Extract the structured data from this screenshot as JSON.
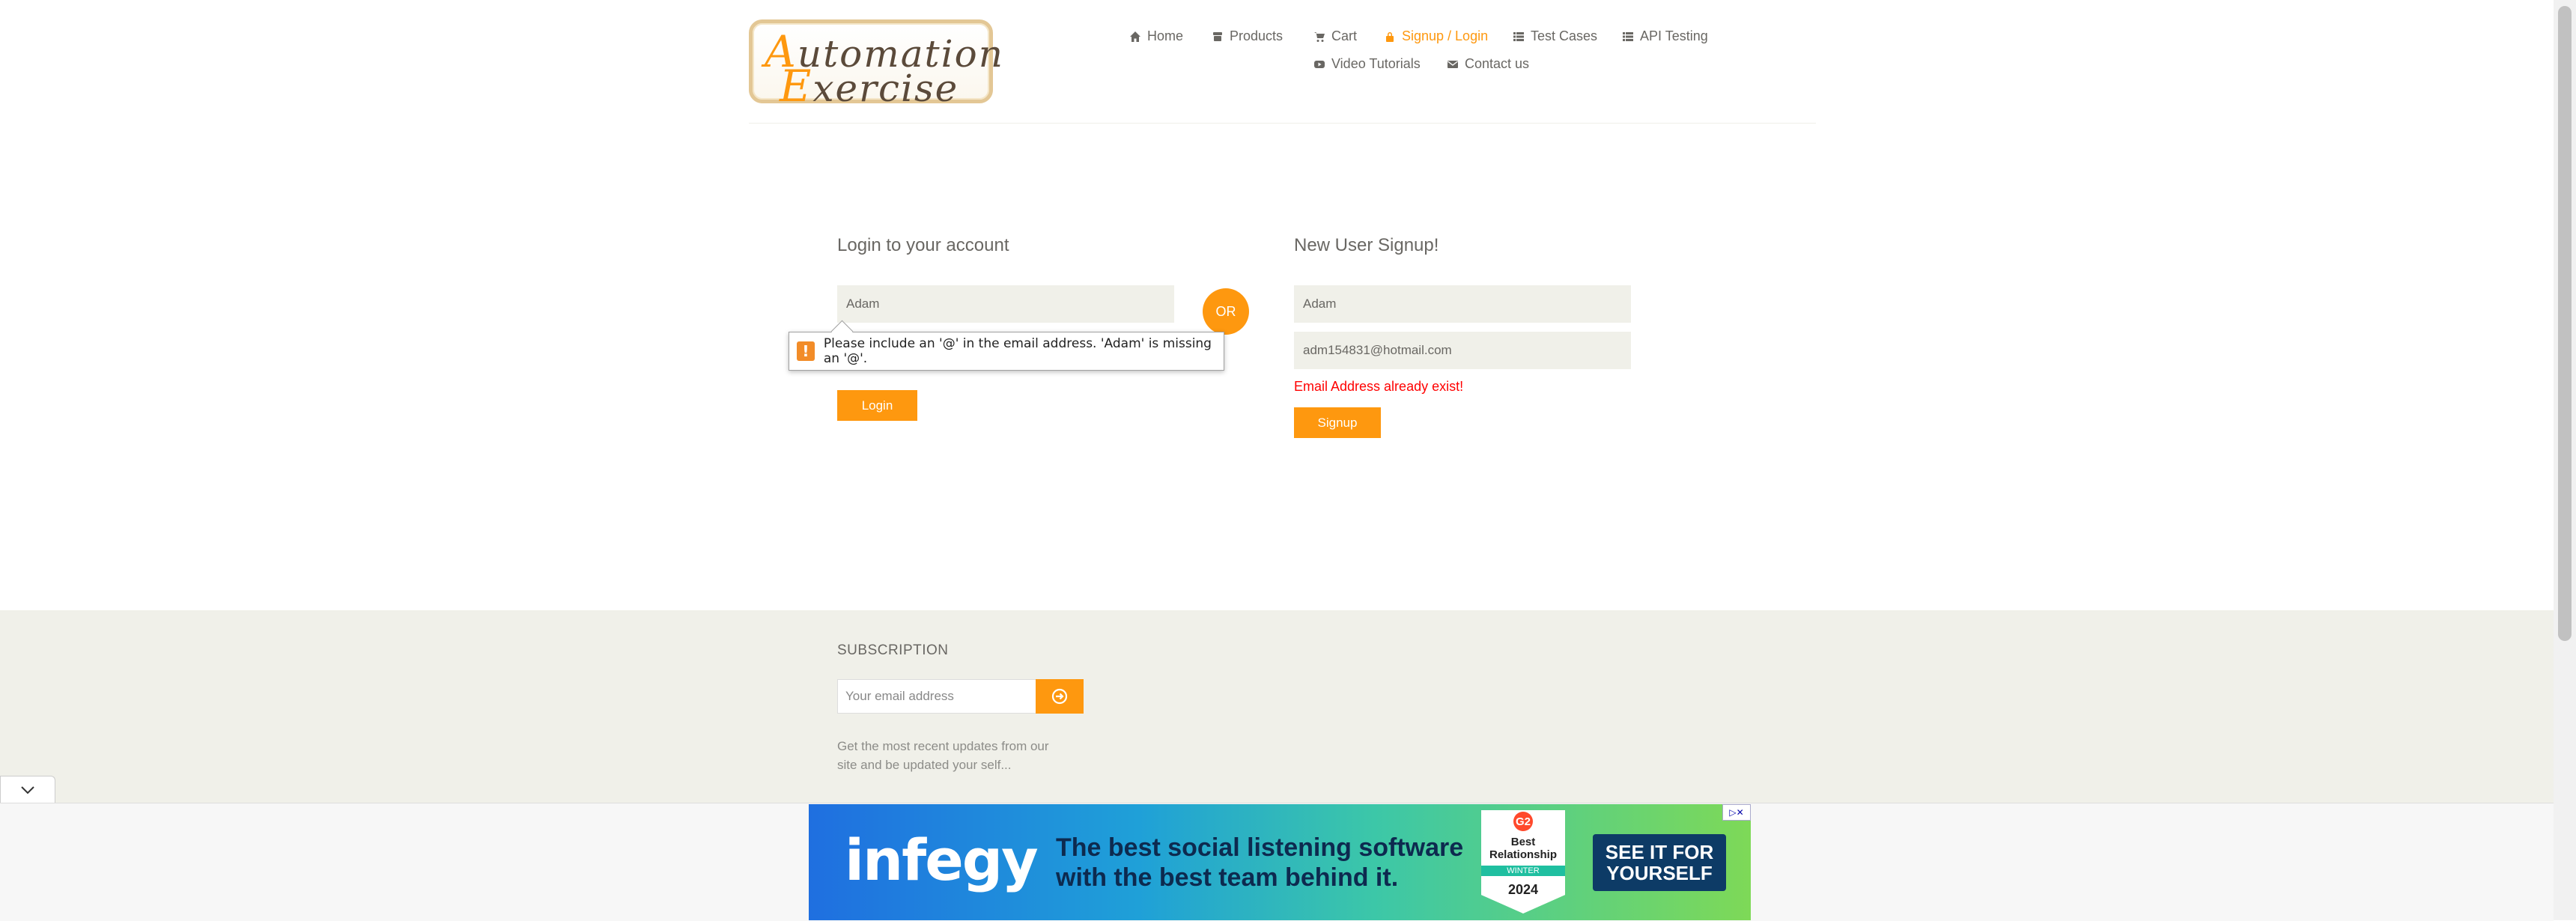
{
  "header": {
    "logo": {
      "line1": "Automation",
      "line2": "Exercise"
    },
    "nav": [
      {
        "label": "Home",
        "icon": "home-icon"
      },
      {
        "label": "Products",
        "icon": "products-icon"
      },
      {
        "label": "Cart",
        "icon": "cart-icon"
      },
      {
        "label": "Signup / Login",
        "icon": "lock-icon",
        "active": true
      },
      {
        "label": "Test Cases",
        "icon": "list-icon"
      },
      {
        "label": "API Testing",
        "icon": "list-icon"
      },
      {
        "label": "Video Tutorials",
        "icon": "youtube-icon"
      },
      {
        "label": "Contact us",
        "icon": "envelope-icon"
      }
    ]
  },
  "login": {
    "title": "Login to your account",
    "email_value": "Adam",
    "button": "Login",
    "validation_tooltip": "Please include an '@' in the email address. 'Adam' is missing an '@'."
  },
  "or_label": "OR",
  "signup": {
    "title": "New User Signup!",
    "name_value": "Adam",
    "email_value": "adm154831@hotmail.com",
    "error": "Email Address already exist!",
    "button": "Signup"
  },
  "footer": {
    "subscription_title": "SUBSCRIPTION",
    "email_placeholder": "Your email address",
    "description": "Get the most recent updates from our site and be updated your self..."
  },
  "ad": {
    "brand": "infegy",
    "headline": "The best social listening software with the best team behind it.",
    "badge_logo": "G2",
    "badge_title": "Best Relationship",
    "badge_season": "WINTER",
    "badge_year": "2024",
    "cta": "SEE IT FOR YOURSELF"
  },
  "colors": {
    "accent": "#fe980f",
    "error": "#ff0000",
    "footer_bg": "#f0f0e9"
  }
}
